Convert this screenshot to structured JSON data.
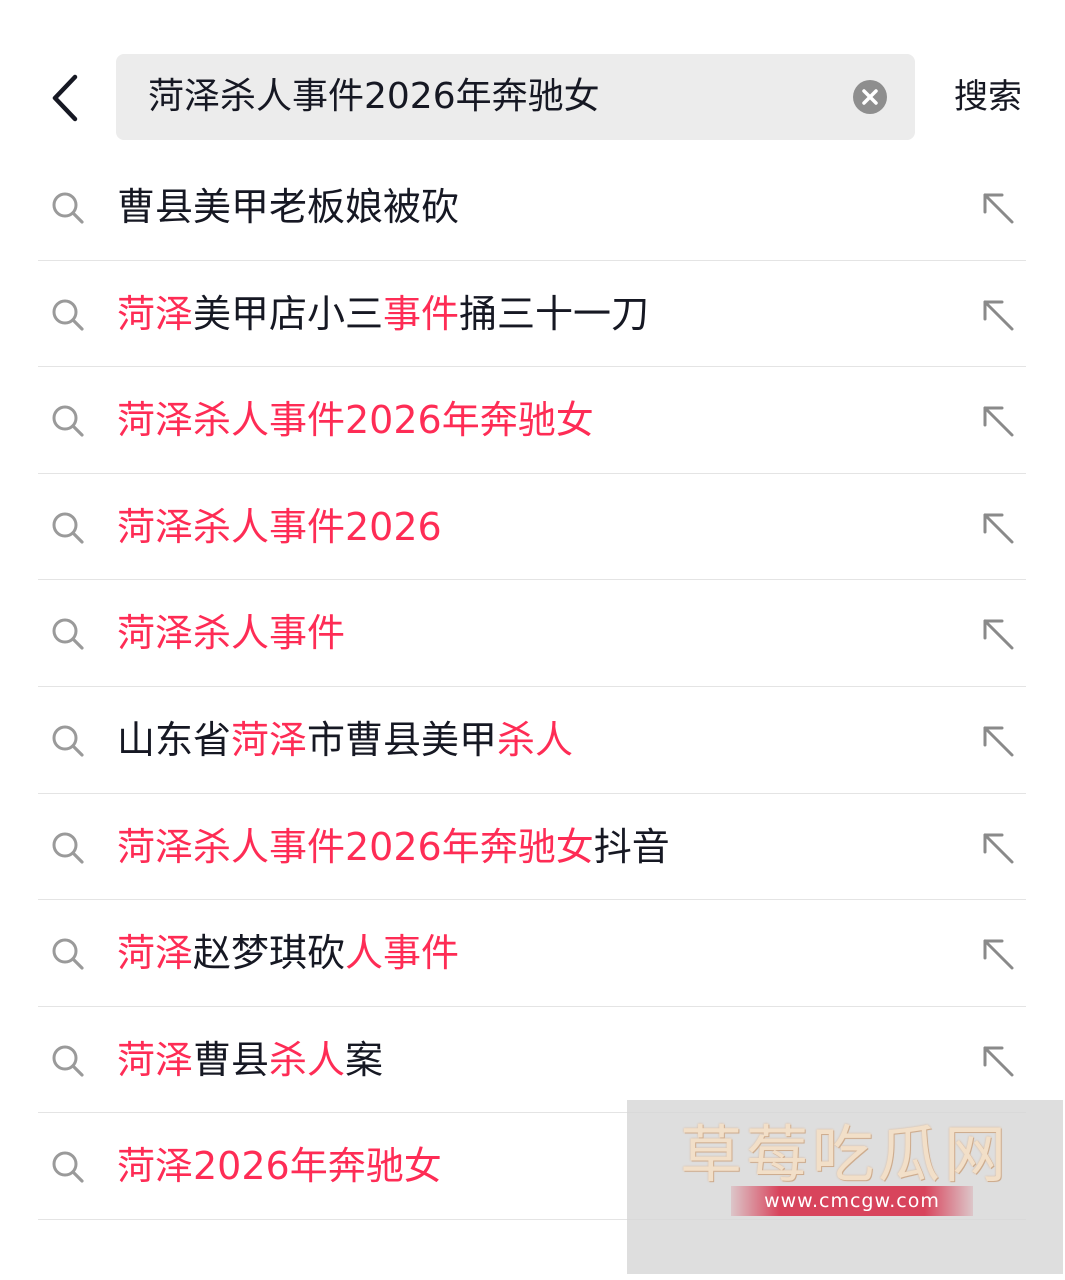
{
  "header": {
    "back_icon": "chevron-left-icon",
    "search_value": "菏泽杀人事件2026年奔驰女",
    "clear_icon": "clear-circle-icon",
    "search_button_label": "搜索"
  },
  "colors": {
    "highlight": "#fe2c55",
    "text": "#161823",
    "search_box_bg": "#ececec",
    "divider": "#e4e4e4"
  },
  "suggestions": [
    {
      "text": "曹县美甲老板娘被砍",
      "segments": [
        [
          "曹县美甲老板娘被砍",
          0
        ]
      ]
    },
    {
      "text": "菏泽美甲店小三事件捅三十一刀",
      "segments": [
        [
          "菏泽",
          1
        ],
        [
          "美甲店小三",
          0
        ],
        [
          "事件",
          1
        ],
        [
          "捅三十一刀",
          0
        ]
      ]
    },
    {
      "text": "菏泽杀人事件2026年奔驰女",
      "segments": [
        [
          "菏泽杀人事件2026年奔驰女",
          1
        ]
      ]
    },
    {
      "text": "菏泽杀人事件2026",
      "segments": [
        [
          "菏泽杀人事件2026",
          1
        ]
      ]
    },
    {
      "text": "菏泽杀人事件",
      "segments": [
        [
          "菏泽杀人事件",
          1
        ]
      ]
    },
    {
      "text": "山东省菏泽市曹县美甲杀人",
      "segments": [
        [
          "山东省",
          0
        ],
        [
          "菏泽",
          1
        ],
        [
          "市曹县美甲",
          0
        ],
        [
          "杀人",
          1
        ]
      ]
    },
    {
      "text": "菏泽杀人事件2026年奔驰女抖音",
      "segments": [
        [
          "菏泽杀人事件2026年奔驰女",
          1
        ],
        [
          "抖音",
          0
        ]
      ]
    },
    {
      "text": "菏泽赵梦琪砍人事件",
      "segments": [
        [
          "菏泽",
          1
        ],
        [
          "赵梦琪砍",
          0
        ],
        [
          "人事件",
          1
        ]
      ]
    },
    {
      "text": "菏泽曹县杀人案",
      "segments": [
        [
          "菏泽",
          1
        ],
        [
          "曹县",
          0
        ],
        [
          "杀人",
          1
        ],
        [
          "案",
          0
        ]
      ]
    },
    {
      "text": "菏泽2026年奔驰女",
      "segments": [
        [
          "菏泽2026年奔驰女",
          1
        ]
      ]
    }
  ],
  "row_icons": {
    "leading": "search-icon",
    "trailing": "arrow-up-left-icon"
  },
  "watermark": {
    "logo_text": "草莓吃瓜网",
    "url": "www.cmcgw.com"
  }
}
